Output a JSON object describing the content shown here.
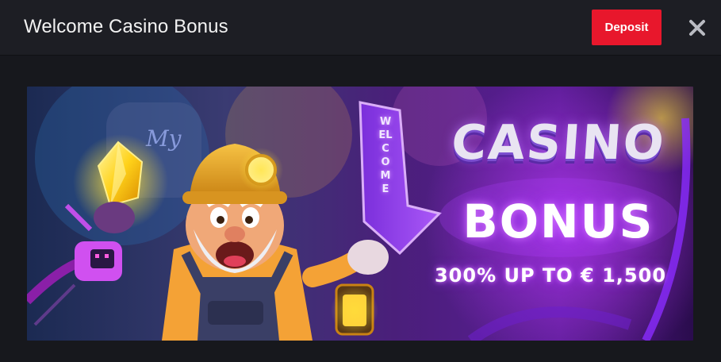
{
  "header": {
    "title": "Welcome Casino Bonus",
    "deposit_label": "Deposit"
  },
  "icons": {
    "close": "close-icon"
  },
  "banner": {
    "headline": "CASINO",
    "subheadline": "BONUS",
    "offer": "300% UP TO € 1,500",
    "sign_text": "WELCOME"
  },
  "colors": {
    "header_bg": "#1d1e24",
    "page_bg": "#17181d",
    "deposit_button": "#e8172c",
    "neon_purple": "#a33cff"
  }
}
